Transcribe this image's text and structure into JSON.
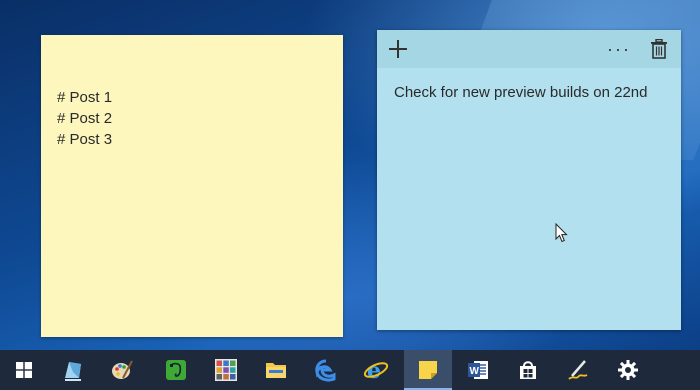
{
  "yellow_note": {
    "lines": [
      "# Post 1",
      "# Post 2",
      "# Post 3"
    ]
  },
  "blue_note": {
    "toolbar": {
      "add_icon": "plus-icon",
      "more_label": "···",
      "delete_icon": "trash-icon"
    },
    "text": "Check for new preview builds on 22nd"
  },
  "taskbar": {
    "items": [
      {
        "name": "start-button",
        "icon": "windows-logo-icon"
      },
      {
        "name": "paint-3d",
        "icon": "paint-3d-icon"
      },
      {
        "name": "paint",
        "icon": "paint-palette-icon"
      },
      {
        "name": "evernote",
        "icon": "evernote-icon"
      },
      {
        "name": "photo-gallery",
        "icon": "photo-gallery-icon"
      },
      {
        "name": "file-explorer",
        "icon": "folder-icon"
      },
      {
        "name": "edge",
        "icon": "edge-icon"
      },
      {
        "name": "internet-explorer",
        "icon": "ie-icon"
      },
      {
        "name": "sticky-notes",
        "icon": "sticky-notes-icon",
        "active": true
      },
      {
        "name": "word",
        "icon": "word-icon"
      },
      {
        "name": "store",
        "icon": "store-icon"
      },
      {
        "name": "pen-app",
        "icon": "pen-icon"
      },
      {
        "name": "settings",
        "icon": "gear-icon"
      }
    ]
  },
  "colors": {
    "yellow_note": "#fdf7bd",
    "blue_note": "#b3e0ee",
    "blue_note_bar": "#a4d6e4",
    "taskbar": "#1e2a3b"
  }
}
